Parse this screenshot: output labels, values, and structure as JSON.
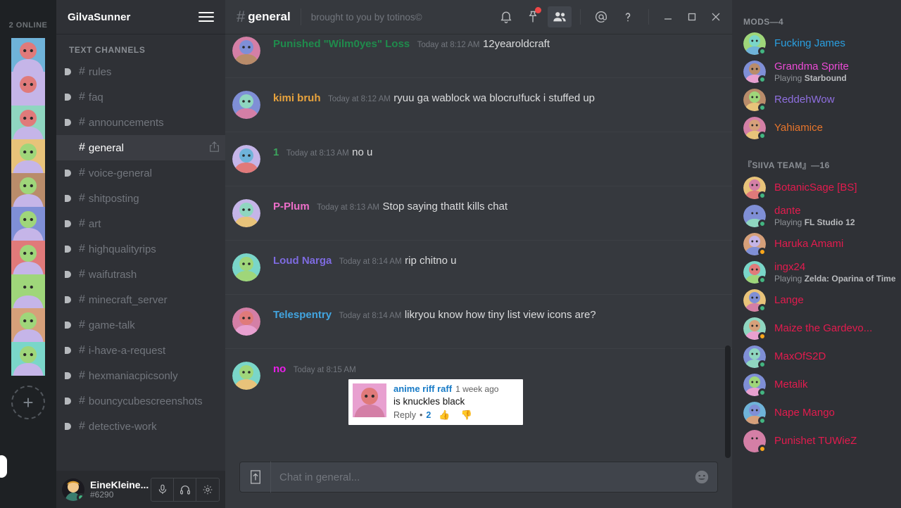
{
  "colors": {
    "online": "#43b581",
    "idle": "#faa61a",
    "accent_blue": "#7289da",
    "notify_red": "#f04747",
    "app_bg": "#36393e",
    "sidebar_bg": "#2f3136",
    "rail_bg": "#1e2124"
  },
  "server_rail": {
    "online_label": "2 ONLINE",
    "add_server_label": "+",
    "add_server_icon": "plus-icon",
    "guild_count": 10
  },
  "guild_header": {
    "name": "GilvaSunner",
    "menu_icon": "hamburger-menu-icon"
  },
  "channels": {
    "category": "TEXT CHANNELS",
    "items": [
      {
        "name": "rules",
        "active": false
      },
      {
        "name": "faq",
        "active": false
      },
      {
        "name": "announcements",
        "active": false
      },
      {
        "name": "general",
        "active": true
      },
      {
        "name": "voice-general",
        "active": false
      },
      {
        "name": "shitposting",
        "active": false
      },
      {
        "name": "art",
        "active": false
      },
      {
        "name": "highqualityrips",
        "active": false
      },
      {
        "name": "waifutrash",
        "active": false
      },
      {
        "name": "minecraft_server",
        "active": false
      },
      {
        "name": "game-talk",
        "active": false
      },
      {
        "name": "i-have-a-request",
        "active": false
      },
      {
        "name": "hexmaniacpicsonly",
        "active": false
      },
      {
        "name": "bouncycubescreenshots",
        "active": false
      },
      {
        "name": "detective-work",
        "active": false
      }
    ],
    "hash_symbol": "#",
    "invite_icon": "create-invite-icon"
  },
  "user_panel": {
    "username": "EineKleine...",
    "discriminator": "#6290",
    "status": "online",
    "buttons": [
      {
        "label": "mute",
        "icon": "microphone-icon"
      },
      {
        "label": "deafen",
        "icon": "headphones-icon"
      },
      {
        "label": "settings",
        "icon": "gear-icon"
      }
    ]
  },
  "topbar": {
    "hash": "#",
    "channel": "general",
    "topic": "brought to you by totinos©",
    "icons": [
      {
        "name": "notifications-icon",
        "glyph": "bell",
        "badge": false,
        "active": false
      },
      {
        "name": "pinned-messages-icon",
        "glyph": "pin",
        "badge": true,
        "active": false
      },
      {
        "name": "member-list-toggle-icon",
        "glyph": "people",
        "badge": false,
        "active": true
      },
      {
        "name": "mentions-icon",
        "glyph": "at",
        "badge": false,
        "active": false
      },
      {
        "name": "help-icon",
        "glyph": "question",
        "badge": false,
        "active": false
      }
    ],
    "window_controls": [
      {
        "name": "minimize-button",
        "glyph": "minimize"
      },
      {
        "name": "maximize-button",
        "glyph": "maximize"
      },
      {
        "name": "close-button",
        "glyph": "close"
      }
    ]
  },
  "messages": [
    {
      "author": "Punished \"Wilm0yes\" Loss",
      "author_color": "#1f8b4c",
      "time": "Today at 8:12 AM",
      "text": "12yearoldcraft",
      "avatar": "windows10-logo-avatar",
      "clipped_top": true
    },
    {
      "author": "kimi bruh",
      "author_color": "#e8a33d",
      "time": "Today at 8:12 AM",
      "text": "ryuu ga wablock wa blocru!fuck i stuffed up",
      "avatar": "santa-hat-man-avatar"
    },
    {
      "author": "1",
      "author_color": "#3ba55c",
      "time": "Today at 8:13 AM",
      "text": "no u",
      "avatar": "dark-hair-boy-avatar"
    },
    {
      "author": "P-Plum",
      "author_color": "#ec6ec8",
      "time": "Today at 8:13 AM",
      "text": "Stop saying thatIt kills chat",
      "avatar": "pink-anime-girl-avatar"
    },
    {
      "author": "Loud Narga",
      "author_color": "#7e6be0",
      "time": "Today at 8:14 AM",
      "text": "rip chitno u",
      "avatar": "red-figure-avatar"
    },
    {
      "author": "Telespentry",
      "author_color": "#42a5e0",
      "time": "Today at 8:14 AM",
      "text": "likryou know how tiny list view icons are?",
      "avatar": "green-hair-cow-avatar"
    },
    {
      "author": "no",
      "author_color": "#e91ee9",
      "time": "Today at 8:15 AM",
      "text": "",
      "avatar": "brown-hair-anime-avatar",
      "embed": "youtube-comment-screenshot"
    }
  ],
  "embed_card": {
    "username": "anime riff raff",
    "age": "1 week ago",
    "comment": "is knuckles black",
    "reply_label": "Reply",
    "separator": "•",
    "reply_count": "2",
    "thumbs_up_icon": "thumbs-up-icon",
    "thumbs_down_icon": "thumbs-down-icon",
    "avatar": "pink-hat-anime-avatar"
  },
  "chat_input": {
    "placeholder": "Chat in general...",
    "value": "",
    "upload_icon": "upload-file-icon",
    "emoji_icon": "emoji-picker-icon"
  },
  "member_list": {
    "groups": [
      {
        "title": "MODS—4",
        "members": [
          {
            "name": "Fucking James",
            "color": "#2a9fe0",
            "status": "online",
            "game": "",
            "avatar": "pink-creature-avatar"
          },
          {
            "name": "Grandma Sprite",
            "color": "#ec4bd6",
            "status": "online",
            "game": "Starbound",
            "avatar": "green-dress-girl-avatar"
          },
          {
            "name": "ReddehWow",
            "color": "#8f6fe0",
            "status": "online",
            "game": "",
            "avatar": "white-moon-avatar"
          },
          {
            "name": "Yahiamice",
            "color": "#e8752b",
            "status": "online",
            "game": "",
            "avatar": "orange-y-logo-avatar"
          }
        ]
      },
      {
        "title": "『SIIVA TEAM』—16",
        "members": [
          {
            "name": "BotanicSage [BS]",
            "color": "#e31b4e",
            "status": "online",
            "game": "",
            "avatar": "pixel-character-avatar"
          },
          {
            "name": "dante",
            "color": "#e31b4e",
            "status": "online",
            "game": "FL Studio 12",
            "avatar": "brown-hair-girl-avatar"
          },
          {
            "name": "Haruka Amami",
            "color": "#e31b4e",
            "status": "idle",
            "game": "",
            "avatar": "idol-girl-avatar"
          },
          {
            "name": "ingx24",
            "color": "#e31b4e",
            "status": "online",
            "game": "Zelda: Oparina of Time",
            "avatar": "sonic-avatar"
          },
          {
            "name": "Lange",
            "color": "#e31b4e",
            "status": "online",
            "game": "",
            "avatar": "blue-creature-avatar"
          },
          {
            "name": "Maize the Gardevo...",
            "color": "#e31b4e",
            "status": "idle",
            "game": "",
            "avatar": "gardevoir-avatar"
          },
          {
            "name": "MaxOfS2D",
            "color": "#e31b4e",
            "status": "online",
            "game": "",
            "avatar": "blue-paper-plane-avatar"
          },
          {
            "name": "Metalik",
            "color": "#e31b4e",
            "status": "online",
            "game": "",
            "avatar": "red-hair-person-avatar"
          },
          {
            "name": "Nape Mango",
            "color": "#e31b4e",
            "status": "online",
            "game": "",
            "avatar": "dark-hair-profile-avatar"
          },
          {
            "name": "Punishet TUWieZ",
            "color": "#e31b4e",
            "status": "idle",
            "game": "",
            "avatar": "blonde-character-avatar"
          }
        ]
      }
    ],
    "playing_prefix": "Playing"
  }
}
